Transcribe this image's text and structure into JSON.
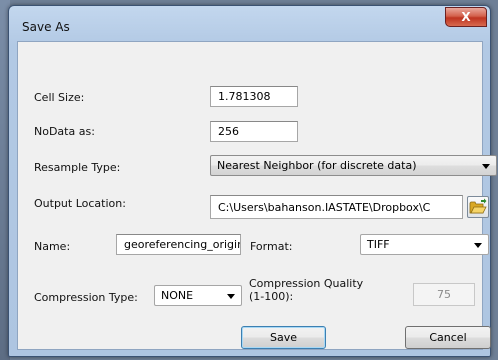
{
  "window": {
    "title": "Save As",
    "close_glyph": "X"
  },
  "cell_size": {
    "label": "Cell Size:",
    "value": "1.781308"
  },
  "nodata": {
    "label": "NoData as:",
    "value": "256"
  },
  "resample": {
    "label": "Resample Type:",
    "value": "Nearest Neighbor (for discrete data)"
  },
  "output": {
    "label": "Output Location:",
    "value": "C:\\Users\\bahanson.IASTATE\\Dropbox\\C",
    "browse_icon": "folder-open-icon"
  },
  "name": {
    "label": "Name:",
    "value": "georeferencing_origir"
  },
  "format": {
    "label": "Format:",
    "value": "TIFF"
  },
  "compression_type": {
    "label": "Compression Type:",
    "value": "NONE"
  },
  "compression_quality": {
    "label_line1": "Compression Quality",
    "label_line2": "(1-100):",
    "value": "75"
  },
  "buttons": {
    "save": "Save",
    "cancel": "Cancel"
  }
}
